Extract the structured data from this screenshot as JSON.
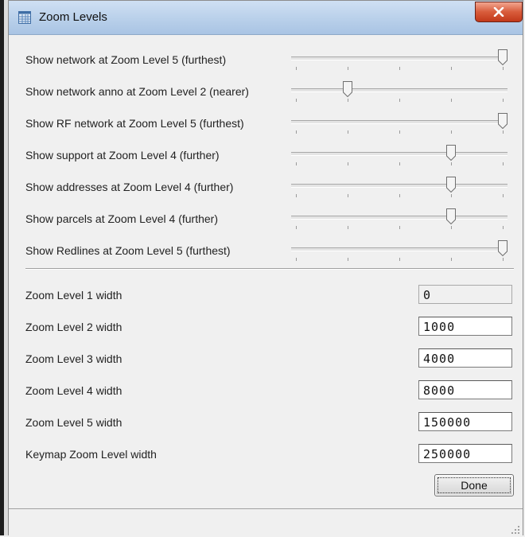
{
  "window": {
    "title": "Zoom Levels",
    "icon": "grid-window-icon",
    "close_icon": "close-x-icon"
  },
  "sliders": [
    {
      "label": "Show network at Zoom Level 5 (furthest)",
      "value": 5,
      "min": 1,
      "max": 5
    },
    {
      "label": "Show network anno at Zoom Level 2 (nearer)",
      "value": 2,
      "min": 1,
      "max": 5
    },
    {
      "label": "Show RF network at Zoom Level 5 (furthest)",
      "value": 5,
      "min": 1,
      "max": 5
    },
    {
      "label": "Show support at Zoom Level 4 (further)",
      "value": 4,
      "min": 1,
      "max": 5
    },
    {
      "label": "Show addresses at Zoom Level 4 (further)",
      "value": 4,
      "min": 1,
      "max": 5
    },
    {
      "label": "Show parcels at Zoom Level 4 (further)",
      "value": 4,
      "min": 1,
      "max": 5
    },
    {
      "label": "Show Redlines at Zoom Level 5 (furthest)",
      "value": 5,
      "min": 1,
      "max": 5
    }
  ],
  "widths": [
    {
      "label": "Zoom Level 1 width",
      "value": "0",
      "readonly": true
    },
    {
      "label": "Zoom Level 2 width",
      "value": "1000",
      "readonly": false
    },
    {
      "label": "Zoom Level 3 width",
      "value": "4000",
      "readonly": false
    },
    {
      "label": "Zoom Level 4 width",
      "value": "8000",
      "readonly": false
    },
    {
      "label": "Zoom Level 5 width",
      "value": "150000",
      "readonly": false
    },
    {
      "label": "Keymap Zoom Level width",
      "value": "250000",
      "readonly": false
    }
  ],
  "buttons": {
    "done": "Done"
  },
  "colors": {
    "titlebar": "#b9d0ea",
    "close_button": "#d85c3b",
    "background": "#f0f0f0"
  }
}
